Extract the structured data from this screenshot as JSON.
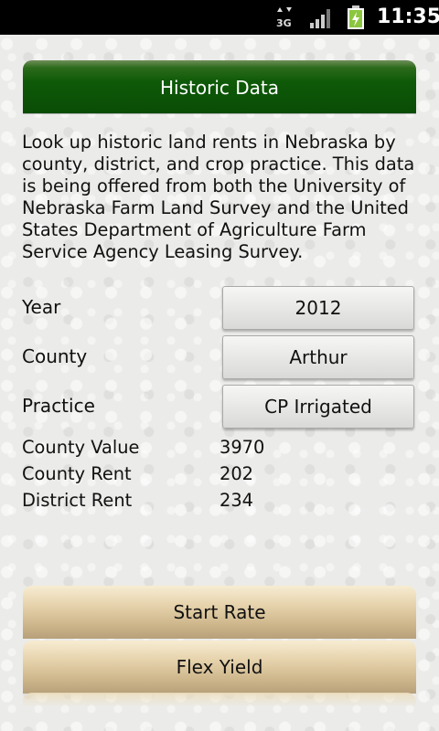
{
  "status_bar": {
    "network": "3G",
    "time": "11:35",
    "icons": [
      "3g-data-icon",
      "signal-icon",
      "battery-charging-icon"
    ]
  },
  "header": {
    "title": "Historic Data"
  },
  "description": "Look up historic land rents in Nebraska by county, district, and crop practice. This data is being offered from both the University of Nebraska Farm Land Survey and the United States Department of Agriculture Farm Service Agency Leasing Survey.",
  "filters": {
    "year": {
      "label": "Year",
      "value": "2012"
    },
    "county": {
      "label": "County",
      "value": "Arthur"
    },
    "practice": {
      "label": "Practice",
      "value": "CP Irrigated"
    }
  },
  "stats": {
    "county_value": {
      "label": "County Value",
      "value": "3970"
    },
    "county_rent": {
      "label": "County Rent",
      "value": "202"
    },
    "district_rent": {
      "label": "District Rent",
      "value": "234"
    }
  },
  "actions": {
    "start_rate": "Start Rate",
    "flex_yield": "Flex Yield"
  },
  "colors": {
    "header_green": "#0e5a08",
    "button_tan": "#e7d4ae",
    "background": "#ebebe9"
  }
}
